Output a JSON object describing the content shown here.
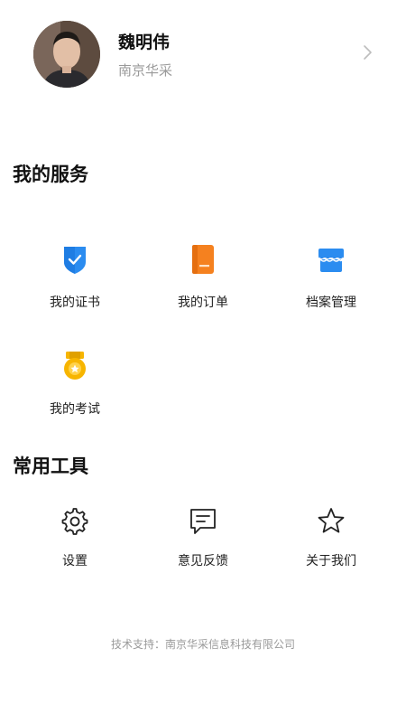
{
  "profile": {
    "name": "魏明伟",
    "organization": "南京华采"
  },
  "services": {
    "title": "我的服务",
    "items": [
      {
        "label": "我的证书",
        "icon": "certificate-shield-icon",
        "color": "#2b8cf0"
      },
      {
        "label": "我的订单",
        "icon": "order-document-icon",
        "color": "#f5811f"
      },
      {
        "label": "档案管理",
        "icon": "archive-store-icon",
        "color": "#2b8cf0"
      },
      {
        "label": "我的考试",
        "icon": "exam-medal-icon",
        "color": "#f7b500"
      }
    ]
  },
  "tools": {
    "title": "常用工具",
    "items": [
      {
        "label": "设置",
        "icon": "gear-icon"
      },
      {
        "label": "意见反馈",
        "icon": "feedback-message-icon"
      },
      {
        "label": "关于我们",
        "icon": "star-icon"
      }
    ]
  },
  "footer": {
    "text": "技术支持：南京华采信息科技有限公司"
  }
}
